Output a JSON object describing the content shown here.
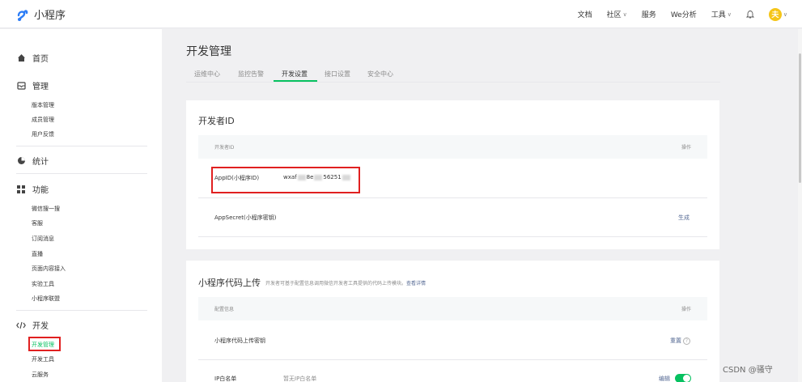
{
  "brand": {
    "name": "小程序"
  },
  "topnav": {
    "items": [
      "文档",
      "社区",
      "服务",
      "We分析",
      "工具"
    ],
    "avatar_glyph": "夫"
  },
  "sidebar": {
    "home": "首页",
    "manage": {
      "label": "管理",
      "items": [
        "版本管理",
        "成员管理",
        "用户反馈"
      ]
    },
    "stats": "统计",
    "features": {
      "label": "功能",
      "items": [
        "微信搜一搜",
        "客服",
        "订阅消息",
        "直播",
        "页面内容接入",
        "实验工具",
        "小程序联盟"
      ]
    },
    "develop": {
      "label": "开发",
      "items": [
        "开发管理",
        "开发工具",
        "云服务"
      ]
    }
  },
  "page": {
    "title": "开发管理",
    "tabs": [
      "运维中心",
      "监控告警",
      "开发设置",
      "接口设置",
      "安全中心"
    ],
    "active_tab": "开发设置"
  },
  "developer_id": {
    "title": "开发者ID",
    "col_id": "开发者ID",
    "col_action": "操作",
    "appid_label": "AppID(小程序ID)",
    "appid_prefix": "wxaf",
    "appid_mid": "8e",
    "appid_suffix": "56251",
    "secret_label": "AppSecret(小程序密钥)",
    "secret_action": "生成"
  },
  "upload": {
    "title": "小程序代码上传",
    "desc": "开发者可基于配置信息调用微信开发者工具提供的代码上传模块。",
    "desc_link": "查看详情",
    "col_config": "配置信息",
    "col_action": "操作",
    "key_label": "小程序代码上传密钥",
    "key_action": "重置",
    "ip_label": "IP白名单",
    "ip_value": "暂无IP白名单",
    "ip_action": "编辑"
  },
  "watermark": "CSDN @骚守",
  "colors": {
    "accent": "#07c160",
    "link": "#576b95",
    "highlight": "#e02020"
  }
}
